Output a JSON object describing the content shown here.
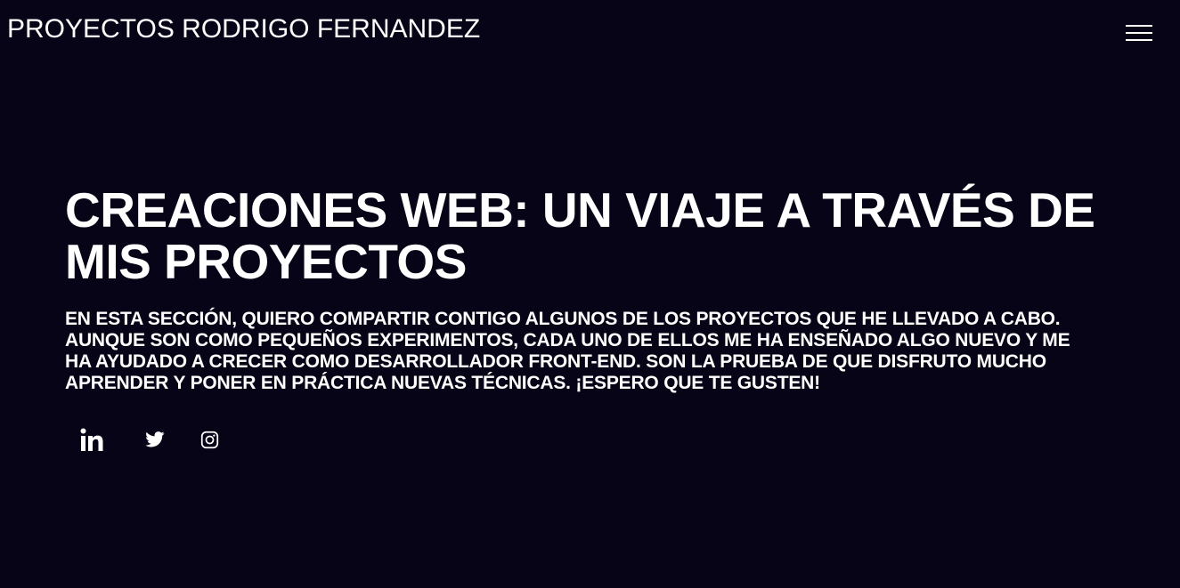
{
  "header": {
    "brand": "PROYECTOS RODRIGO FERNANDEZ",
    "menu_icon": "hamburger-menu-icon"
  },
  "hero": {
    "title": "CREACIONES WEB: UN VIAJE A TRAVÉS DE MIS PROYECTOS",
    "text": "EN ESTA SECCIÓN, QUIERO COMPARTIR CONTIGO ALGUNOS DE LOS PROYECTOS QUE HE LLEVADO A CABO. AUNQUE SON COMO PEQUEÑOS EXPERIMENTOS, CADA UNO DE ELLOS ME HA ENSEÑADO ALGO NUEVO Y ME HA AYUDADO A CRECER COMO DESARROLLADOR FRONT-END. SON LA PRUEBA DE QUE DISFRUTO MUCHO APRENDER Y PONER EN PRÁCTICA NUEVAS TÉCNICAS. ¡ESPERO QUE TE GUSTEN!"
  },
  "socials": [
    {
      "icon": "linkedin-icon"
    },
    {
      "icon": "twitter-icon"
    },
    {
      "icon": "instagram-icon"
    }
  ],
  "colors": {
    "background": "#070417",
    "text": "#ffffff"
  }
}
